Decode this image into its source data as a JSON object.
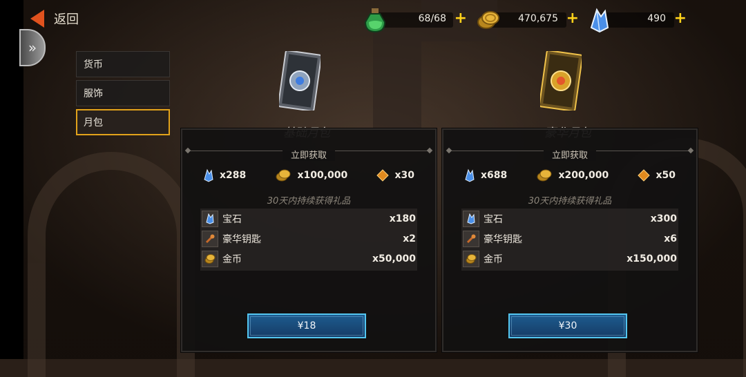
{
  "header": {
    "back_label": "返回",
    "resources": [
      {
        "name": "stamina",
        "icon": "stamina-potion-icon",
        "value": "68/68"
      },
      {
        "name": "gold",
        "icon": "gold-coins-icon",
        "value": "470,675"
      },
      {
        "name": "gems",
        "icon": "blue-crystal-icon",
        "value": "490"
      }
    ],
    "plus_symbol": "+"
  },
  "menu": {
    "items": [
      {
        "label": "货币",
        "active": false
      },
      {
        "label": "服饰",
        "active": false
      },
      {
        "label": "月包",
        "active": true
      }
    ]
  },
  "packs": [
    {
      "title": "基础月包",
      "instant_label": "立即获取",
      "instant": [
        {
          "icon": "blue-crystal-icon",
          "amount": "x288"
        },
        {
          "icon": "gold-coins-icon",
          "amount": "x100,000"
        },
        {
          "icon": "orange-gem-icon",
          "amount": "x30"
        }
      ],
      "daily_subtitle": "30天内持续获得礼品",
      "daily": [
        {
          "icon": "blue-crystal-icon",
          "name": "宝石",
          "amount": "x180"
        },
        {
          "icon": "deluxe-key-icon",
          "name": "豪华钥匙",
          "amount": "x2"
        },
        {
          "icon": "gold-coins-icon",
          "name": "金币",
          "amount": "x50,000"
        }
      ],
      "price": "¥18"
    },
    {
      "title": "豪华月包",
      "instant_label": "立即获取",
      "instant": [
        {
          "icon": "blue-crystal-icon",
          "amount": "x688"
        },
        {
          "icon": "gold-coins-icon",
          "amount": "x200,000"
        },
        {
          "icon": "orange-gem-icon",
          "amount": "x50"
        }
      ],
      "daily_subtitle": "30天内持续获得礼品",
      "daily": [
        {
          "icon": "blue-crystal-icon",
          "name": "宝石",
          "amount": "x300"
        },
        {
          "icon": "deluxe-key-icon",
          "name": "豪华钥匙",
          "amount": "x6"
        },
        {
          "icon": "gold-coins-icon",
          "name": "金币",
          "amount": "x150,000"
        }
      ],
      "price": "¥30"
    }
  ]
}
